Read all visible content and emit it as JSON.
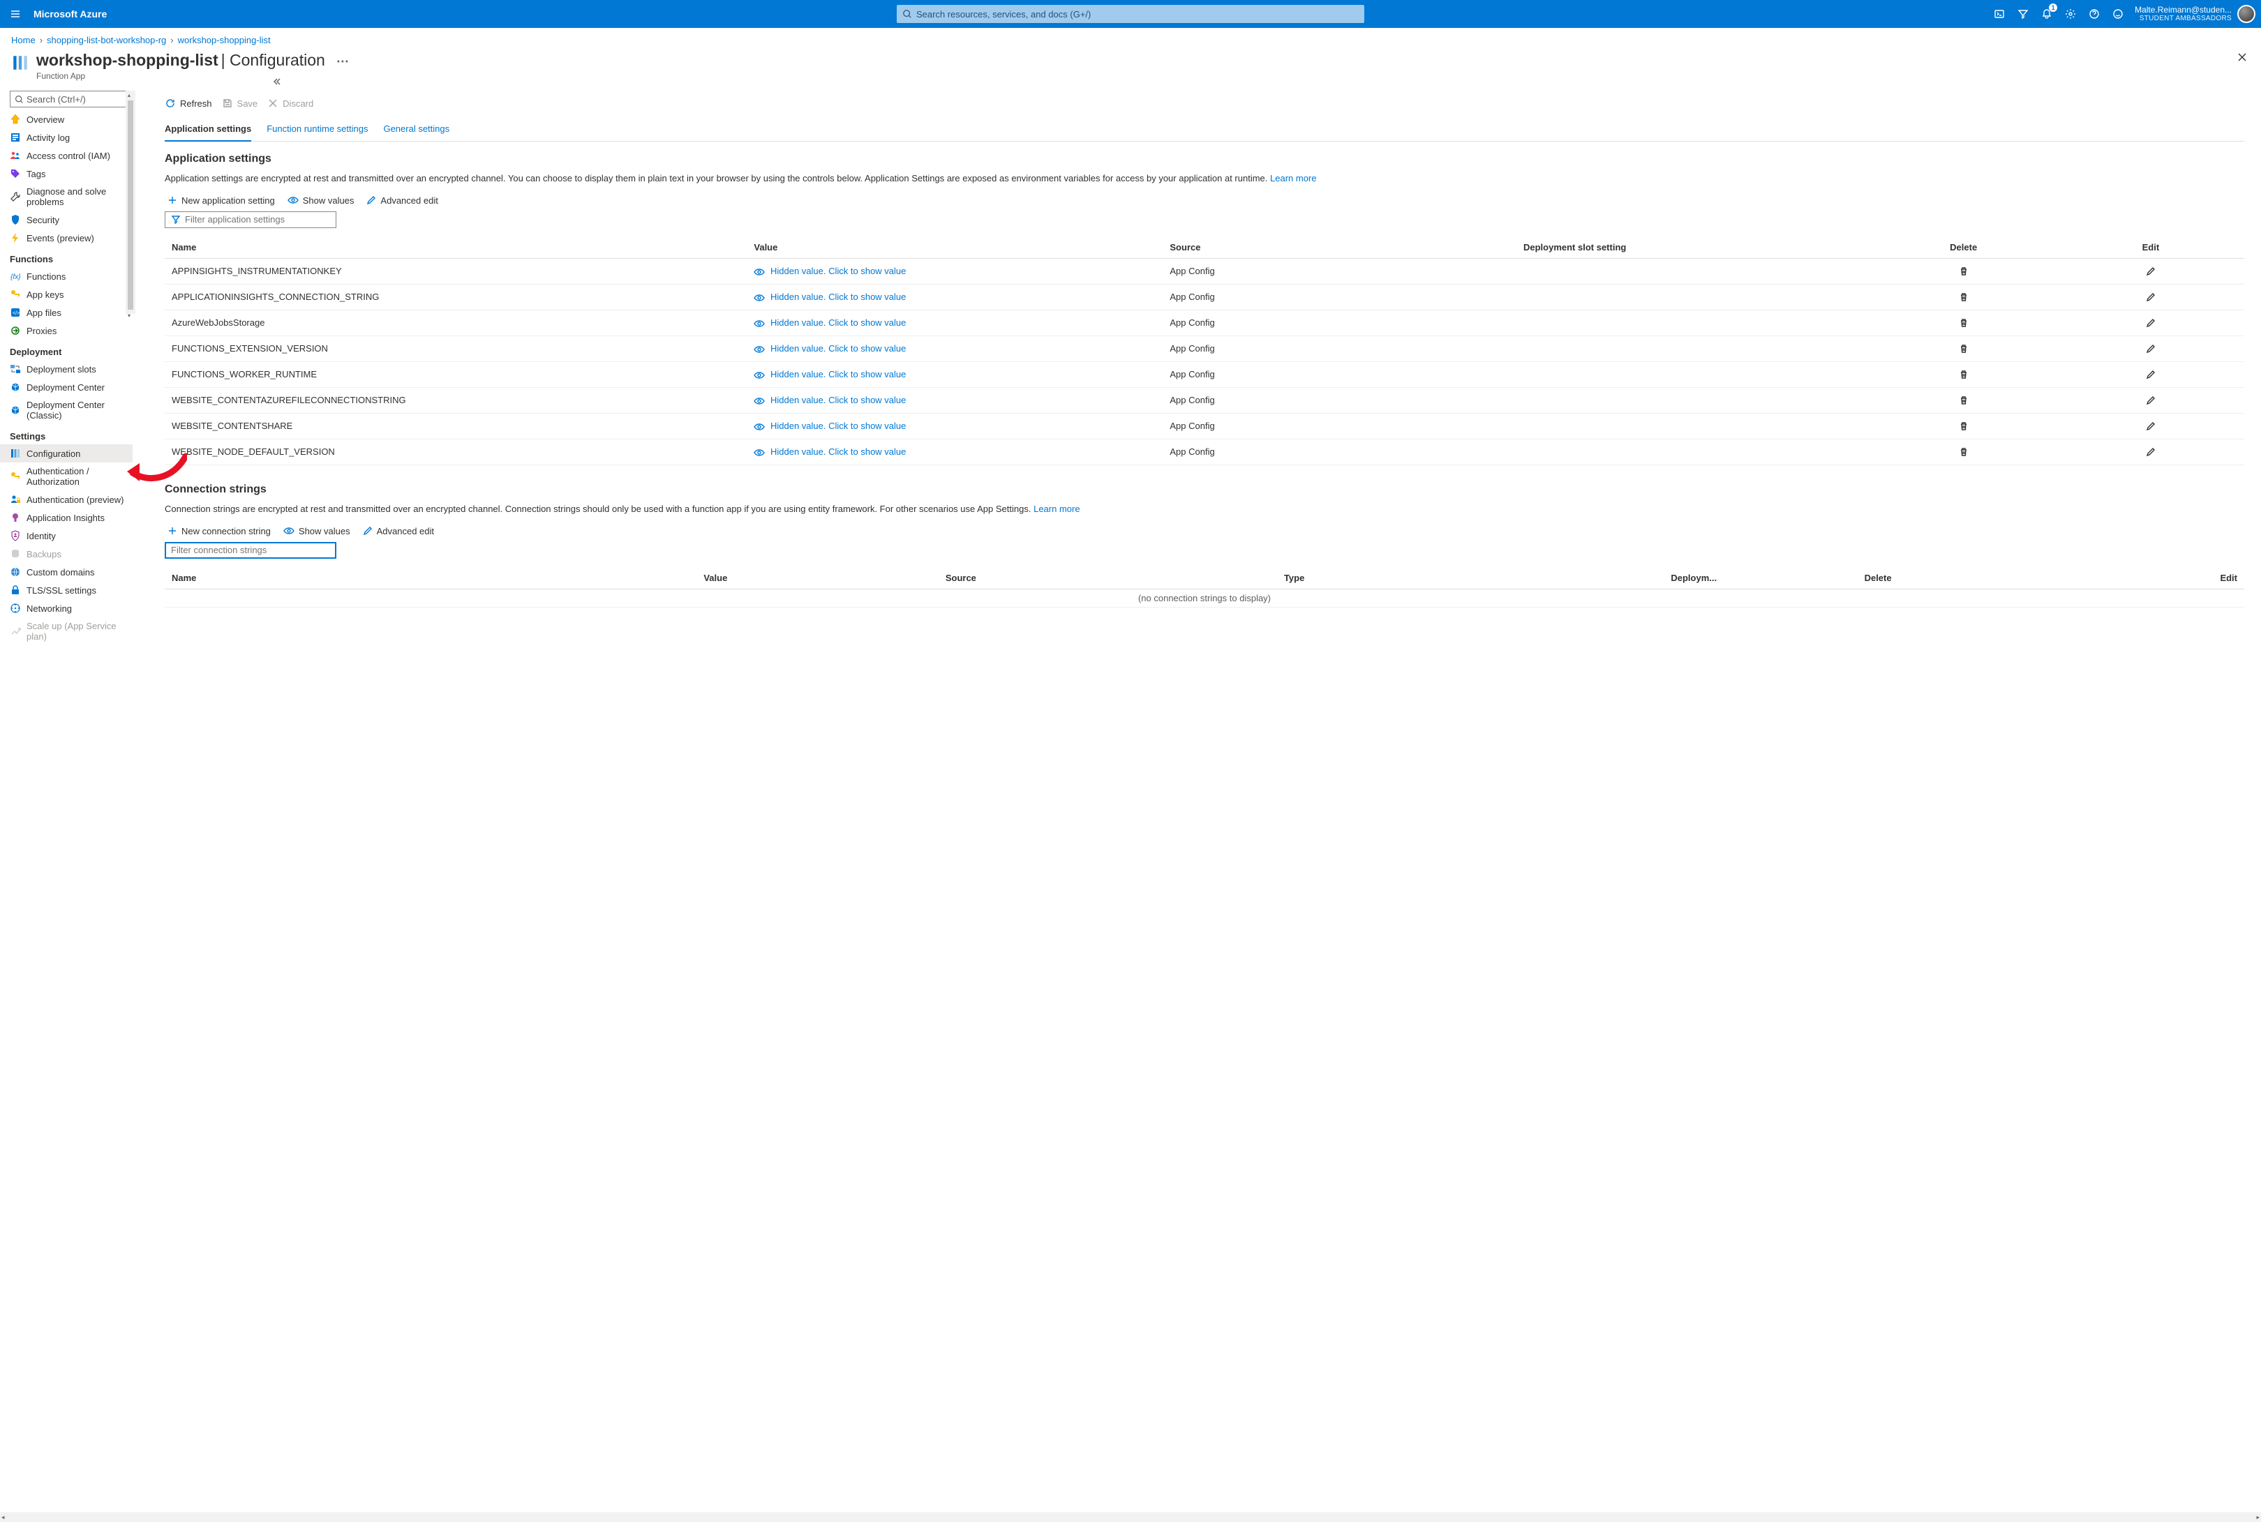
{
  "topbar": {
    "brand": "Microsoft Azure",
    "search_placeholder": "Search resources, services, and docs (G+/)",
    "notif_count": "1",
    "account_name": "Malte.Reimann@studen...",
    "account_role": "STUDENT AMBASSADORS"
  },
  "breadcrumbs": [
    "Home",
    "shopping-list-bot-workshop-rg",
    "workshop-shopping-list"
  ],
  "page": {
    "title": "workshop-shopping-list",
    "title_suffix": "| Configuration",
    "subtitle": "Function App"
  },
  "sidebar": {
    "search_placeholder": "Search (Ctrl+/)",
    "items1": [
      {
        "icon": "overview",
        "label": "Overview"
      },
      {
        "icon": "activity",
        "label": "Activity log"
      },
      {
        "icon": "access",
        "label": "Access control (IAM)"
      },
      {
        "icon": "tag",
        "label": "Tags"
      },
      {
        "icon": "wrench",
        "label": "Diagnose and solve problems"
      },
      {
        "icon": "shield",
        "label": "Security"
      },
      {
        "icon": "bolt",
        "label": "Events (preview)"
      }
    ],
    "group_functions": "Functions",
    "items_functions": [
      {
        "icon": "fx",
        "label": "Functions"
      },
      {
        "icon": "key",
        "label": "App keys"
      },
      {
        "icon": "appfiles",
        "label": "App files"
      },
      {
        "icon": "proxy",
        "label": "Proxies"
      }
    ],
    "group_deployment": "Deployment",
    "items_deployment": [
      {
        "icon": "slots",
        "label": "Deployment slots"
      },
      {
        "icon": "depcenter",
        "label": "Deployment Center"
      },
      {
        "icon": "depcenter",
        "label": "Deployment Center (Classic)"
      }
    ],
    "group_settings": "Settings",
    "items_settings": [
      {
        "icon": "config",
        "label": "Configuration",
        "selected": true
      },
      {
        "icon": "key",
        "label": "Authentication / Authorization"
      },
      {
        "icon": "userlock",
        "label": "Authentication (preview)"
      },
      {
        "icon": "insights",
        "label": "Application Insights"
      },
      {
        "icon": "identity",
        "label": "Identity"
      },
      {
        "icon": "backup",
        "label": "Backups",
        "disabled": true
      },
      {
        "icon": "globe",
        "label": "Custom domains"
      },
      {
        "icon": "lock",
        "label": "TLS/SSL settings"
      },
      {
        "icon": "net",
        "label": "Networking"
      },
      {
        "icon": "scale",
        "label": "Scale up (App Service plan)",
        "disabled": true
      }
    ]
  },
  "cmdbar": {
    "refresh": "Refresh",
    "save": "Save",
    "discard": "Discard"
  },
  "tabs": [
    "Application settings",
    "Function runtime settings",
    "General settings"
  ],
  "appsettings": {
    "title": "Application settings",
    "desc_before": "Application settings are encrypted at rest and transmitted over an encrypted channel. You can choose to display them in plain text in your browser by using the controls below. Application Settings are exposed as environment variables for access by your application at runtime. ",
    "learn_more": "Learn more",
    "new_btn": "New application setting",
    "show_values": "Show values",
    "advanced_edit": "Advanced edit",
    "filter_placeholder": "Filter application settings",
    "columns": {
      "name": "Name",
      "value": "Value",
      "source": "Source",
      "dslot": "Deployment slot setting",
      "delete": "Delete",
      "edit": "Edit"
    },
    "hidden_label": "Hidden value. Click to show value",
    "source_val": "App Config",
    "rows": [
      "APPINSIGHTS_INSTRUMENTATIONKEY",
      "APPLICATIONINSIGHTS_CONNECTION_STRING",
      "AzureWebJobsStorage",
      "FUNCTIONS_EXTENSION_VERSION",
      "FUNCTIONS_WORKER_RUNTIME",
      "WEBSITE_CONTENTAZUREFILECONNECTIONSTRING",
      "WEBSITE_CONTENTSHARE",
      "WEBSITE_NODE_DEFAULT_VERSION"
    ]
  },
  "connstrings": {
    "title": "Connection strings",
    "desc_before": "Connection strings are encrypted at rest and transmitted over an encrypted channel. Connection strings should only be used with a function app if you are using entity framework. For other scenarios use App Settings. ",
    "learn_more": "Learn more",
    "new_btn": "New connection string",
    "show_values": "Show values",
    "advanced_edit": "Advanced edit",
    "filter_placeholder": "Filter connection strings",
    "columns": {
      "name": "Name",
      "value": "Value",
      "source": "Source",
      "type": "Type",
      "dslot": "Deploym...",
      "delete": "Delete",
      "edit": "Edit"
    },
    "empty": "(no connection strings to display)"
  }
}
